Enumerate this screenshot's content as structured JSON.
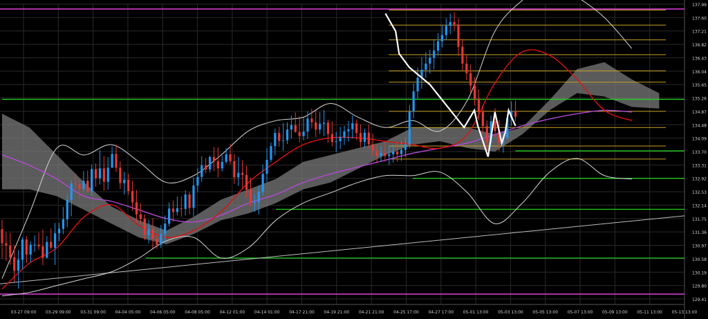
{
  "chart_data": {
    "type": "candlestick",
    "y_ticks": [
      "137.99",
      "137.60",
      "137.21",
      "136.82",
      "136.43",
      "136.04",
      "135.65",
      "135.26",
      "134.87",
      "134.48",
      "134.09",
      "133.70",
      "133.31",
      "132.92",
      "132.53",
      "132.14",
      "131.75",
      "131.36",
      "130.97",
      "130.58",
      "130.19",
      "129.80",
      "129.41"
    ],
    "x_ticks": [
      "03-27 09:00",
      "03-29 09:00",
      "03-31 09:00",
      "04-04 05:00",
      "04-06 05:00",
      "04-08 05:00",
      "04-12 01:00",
      "04-14 01:00",
      "04-17 21:00",
      "04-19 21:00",
      "04-21 21:00",
      "04-25 17:00",
      "04-27 17:00",
      "05-01 13:00",
      "05-03 13:00",
      "05-05 13:00",
      "05-07 13:00",
      "05-09 13:00",
      "05-11 13:00",
      "05-13 13:00"
    ],
    "ylim": [
      129.41,
      137.99
    ],
    "grid": true,
    "colors": {
      "background": "#000000",
      "grid": "#2a2a2a",
      "up_candle": "#2196f3",
      "down_candle": "#e53935",
      "ma_red": "#e01010",
      "ma_purple": "#b24bd6",
      "bollinger": "#d8d8d8",
      "cloud": "#7a7a7a",
      "support_green": "#22e022",
      "range_magenta": "#e040e0",
      "fib_gold": "#c9a227",
      "zigzag": "#ffffff",
      "trendline": "#bdbdbd"
    },
    "horizontal_levels": {
      "magenta": [
        137.85,
        129.55
      ],
      "green": [
        135.22,
        133.72,
        132.92,
        132.02,
        130.6
      ],
      "gold": [
        137.82,
        137.38,
        136.95,
        136.52,
        136.05,
        135.72,
        134.87,
        134.4,
        133.86,
        133.48
      ]
    },
    "trendline": {
      "start": [
        0,
        129.85
      ],
      "end": [
        200,
        131.83
      ]
    },
    "ohlc": [
      [
        131.44,
        131.71,
        130.58,
        131.03
      ],
      [
        131.03,
        131.35,
        130.52,
        130.96
      ],
      [
        130.96,
        131.33,
        130.4,
        130.62
      ],
      [
        130.62,
        130.96,
        129.9,
        130.23
      ],
      [
        130.23,
        130.83,
        129.71,
        130.55
      ],
      [
        130.55,
        131.21,
        130.28,
        131.14
      ],
      [
        131.14,
        131.24,
        130.45,
        130.7
      ],
      [
        130.7,
        131.09,
        130.47,
        130.99
      ],
      [
        130.99,
        131.26,
        130.78,
        130.99
      ],
      [
        130.99,
        131.34,
        130.84,
        130.94
      ],
      [
        130.94,
        131.42,
        130.39,
        130.61
      ],
      [
        130.61,
        131.24,
        130.59,
        131.07
      ],
      [
        131.07,
        131.46,
        130.85,
        130.9
      ],
      [
        130.9,
        131.62,
        130.4,
        131.32
      ],
      [
        131.32,
        131.62,
        131.09,
        131.45
      ],
      [
        131.45,
        132.09,
        131.3,
        131.73
      ],
      [
        131.73,
        132.45,
        131.5,
        132.29
      ],
      [
        132.29,
        132.86,
        131.82,
        132.77
      ],
      [
        132.77,
        133.06,
        132.59,
        132.75
      ],
      [
        132.75,
        132.91,
        132.34,
        132.61
      ],
      [
        132.61,
        133.13,
        132.54,
        132.85
      ],
      [
        132.85,
        133.15,
        132.52,
        132.54
      ],
      [
        132.54,
        133.32,
        132.42,
        133.19
      ],
      [
        133.19,
        133.35,
        132.68,
        132.92
      ],
      [
        132.92,
        133.74,
        132.74,
        133.21
      ],
      [
        133.21,
        133.57,
        132.56,
        132.82
      ],
      [
        132.82,
        133.54,
        132.59,
        133.23
      ],
      [
        133.23,
        133.85,
        133.23,
        133.63
      ],
      [
        133.63,
        133.91,
        133.1,
        133.23
      ],
      [
        133.23,
        133.41,
        132.61,
        132.78
      ],
      [
        132.78,
        133.11,
        132.45,
        132.88
      ],
      [
        132.88,
        133.05,
        132.44,
        132.55
      ],
      [
        132.55,
        132.85,
        131.97,
        132.22
      ],
      [
        132.22,
        132.58,
        131.64,
        131.87
      ],
      [
        131.87,
        132.2,
        131.58,
        131.74
      ],
      [
        131.74,
        131.87,
        131.12,
        131.27
      ],
      [
        131.27,
        131.71,
        131.03,
        131.44
      ],
      [
        131.44,
        131.76,
        130.88,
        131.16
      ],
      [
        131.16,
        131.3,
        130.87,
        130.99
      ],
      [
        130.99,
        131.56,
        130.89,
        131.3
      ],
      [
        131.3,
        131.84,
        131.05,
        131.6
      ],
      [
        131.6,
        132.22,
        131.52,
        132.04
      ],
      [
        132.04,
        132.28,
        131.66,
        131.94
      ],
      [
        131.94,
        132.39,
        131.84,
        132.05
      ],
      [
        132.05,
        132.39,
        131.8,
        132.03
      ],
      [
        132.03,
        132.57,
        131.84,
        132.45
      ],
      [
        132.45,
        132.52,
        131.87,
        132.06
      ],
      [
        132.06,
        132.95,
        131.8,
        132.71
      ],
      [
        132.71,
        133.22,
        132.52,
        132.96
      ],
      [
        132.96,
        133.56,
        132.82,
        133.3
      ],
      [
        133.3,
        133.51,
        133.07,
        133.18
      ],
      [
        133.18,
        133.58,
        133.09,
        133.54
      ],
      [
        133.54,
        133.83,
        133.13,
        133.42
      ],
      [
        133.42,
        133.82,
        132.95,
        133.21
      ],
      [
        133.21,
        133.59,
        133.12,
        133.4
      ],
      [
        133.4,
        133.8,
        133.35,
        133.62
      ],
      [
        133.62,
        133.93,
        133.33,
        133.42
      ],
      [
        133.42,
        133.63,
        132.76,
        132.95
      ],
      [
        132.95,
        133.55,
        132.7,
        133.08
      ],
      [
        133.08,
        133.45,
        132.62,
        133.02
      ],
      [
        133.02,
        133.29,
        132.36,
        132.59
      ],
      [
        132.59,
        132.94,
        132.11,
        132.22
      ],
      [
        132.22,
        132.47,
        131.94,
        132.22
      ],
      [
        132.22,
        132.71,
        131.87,
        132.53
      ],
      [
        132.53,
        133.32,
        132.43,
        133.05
      ],
      [
        133.05,
        133.8,
        132.81,
        133.46
      ],
      [
        133.46,
        133.96,
        133.39,
        133.86
      ],
      [
        133.86,
        134.37,
        133.59,
        134.24
      ],
      [
        134.24,
        134.42,
        133.84,
        134.01
      ],
      [
        134.01,
        134.53,
        133.72,
        134.03
      ],
      [
        134.03,
        134.55,
        133.92,
        134.34
      ],
      [
        134.34,
        134.75,
        134.07,
        134.47
      ],
      [
        134.47,
        134.84,
        134.25,
        134.27
      ],
      [
        134.27,
        134.73,
        133.96,
        134.15
      ],
      [
        134.15,
        134.69,
        134.03,
        134.28
      ],
      [
        134.28,
        134.87,
        134.07,
        134.66
      ],
      [
        134.66,
        134.95,
        134.37,
        134.55
      ],
      [
        134.55,
        134.9,
        134.12,
        134.34
      ],
      [
        134.34,
        134.85,
        134.21,
        134.51
      ],
      [
        134.51,
        134.91,
        134.15,
        134.54
      ],
      [
        134.54,
        134.63,
        133.95,
        134.21
      ],
      [
        134.21,
        134.58,
        133.85,
        133.98
      ],
      [
        133.98,
        134.27,
        133.69,
        134.0
      ],
      [
        134.0,
        134.42,
        133.77,
        134.12
      ],
      [
        134.12,
        134.45,
        133.89,
        134.29
      ],
      [
        134.29,
        134.59,
        133.99,
        134.35
      ],
      [
        134.35,
        134.75,
        134.08,
        134.52
      ],
      [
        134.52,
        134.63,
        134.03,
        134.24
      ],
      [
        134.24,
        134.49,
        133.83,
        133.98
      ],
      [
        133.98,
        134.37,
        133.82,
        134.25
      ],
      [
        134.25,
        134.49,
        133.78,
        133.91
      ],
      [
        133.91,
        134.22,
        133.58,
        133.72
      ],
      [
        133.72,
        133.91,
        133.36,
        133.57
      ],
      [
        133.57,
        133.86,
        133.4,
        133.66
      ],
      [
        133.66,
        133.98,
        133.41,
        133.57
      ],
      [
        133.57,
        133.87,
        133.31,
        133.62
      ],
      [
        133.62,
        133.89,
        133.37,
        133.7
      ],
      [
        133.7,
        133.97,
        133.4,
        133.62
      ],
      [
        133.62,
        134.01,
        133.43,
        133.75
      ],
      [
        133.75,
        134.09,
        133.55,
        133.91
      ],
      [
        133.91,
        135.06,
        133.8,
        134.87
      ],
      [
        134.87,
        135.68,
        134.66,
        135.45
      ],
      [
        135.45,
        136.14,
        135.24,
        135.85
      ],
      [
        135.85,
        136.45,
        135.53,
        136.08
      ],
      [
        136.08,
        136.59,
        135.84,
        136.26
      ],
      [
        136.26,
        136.66,
        135.97,
        136.43
      ],
      [
        136.43,
        136.97,
        136.09,
        136.64
      ],
      [
        136.64,
        137.15,
        136.5,
        136.91
      ],
      [
        136.91,
        137.38,
        136.73,
        137.09
      ],
      [
        137.09,
        137.58,
        136.96,
        137.36
      ],
      [
        137.36,
        137.72,
        137.12,
        137.47
      ],
      [
        137.47,
        137.75,
        137.22,
        137.4
      ],
      [
        137.4,
        137.58,
        136.48,
        136.75
      ],
      [
        136.75,
        136.98,
        136.06,
        136.26
      ],
      [
        136.26,
        136.53,
        135.78,
        135.98
      ],
      [
        135.98,
        136.23,
        135.41,
        135.62
      ],
      [
        135.62,
        135.86,
        135.04,
        135.24
      ],
      [
        135.24,
        135.51,
        134.61,
        134.85
      ],
      [
        134.85,
        135.06,
        134.22,
        134.44
      ],
      [
        134.44,
        134.61,
        133.71,
        133.96
      ],
      [
        133.96,
        134.74,
        133.82,
        134.58
      ],
      [
        134.58,
        134.96,
        134.12,
        134.3
      ],
      [
        134.3,
        134.61,
        133.72,
        133.95
      ],
      [
        133.95,
        134.27,
        133.67,
        134.1
      ],
      [
        134.1,
        134.78,
        134.04,
        134.68
      ],
      [
        134.68,
        135.16,
        134.45,
        134.88
      ],
      [
        134.88,
        135.18,
        134.58,
        134.71
      ]
    ],
    "ma_red": [
      [
        0,
        129.7
      ],
      [
        8,
        130.45
      ],
      [
        16,
        130.9
      ],
      [
        24,
        131.8
      ],
      [
        32,
        132.15
      ],
      [
        40,
        131.55
      ],
      [
        48,
        131.2
      ],
      [
        56,
        131.4
      ],
      [
        64,
        131.95
      ],
      [
        72,
        132.8
      ],
      [
        80,
        133.4
      ],
      [
        88,
        133.9
      ],
      [
        96,
        134.1
      ],
      [
        104,
        134.1
      ],
      [
        112,
        134.0
      ],
      [
        120,
        133.9
      ],
      [
        128,
        133.8
      ],
      [
        136,
        134.2
      ],
      [
        144,
        135.7
      ],
      [
        152,
        136.6
      ],
      [
        160,
        136.5
      ],
      [
        168,
        135.8
      ],
      [
        176,
        134.9
      ],
      [
        184,
        134.6
      ]
    ],
    "ma_purple": [
      [
        0,
        133.6
      ],
      [
        8,
        133.3
      ],
      [
        16,
        132.9
      ],
      [
        24,
        132.4
      ],
      [
        32,
        132.25
      ],
      [
        40,
        132.0
      ],
      [
        48,
        131.75
      ],
      [
        56,
        131.65
      ],
      [
        64,
        131.85
      ],
      [
        72,
        132.2
      ],
      [
        80,
        132.45
      ],
      [
        88,
        132.8
      ],
      [
        96,
        133.05
      ],
      [
        104,
        133.25
      ],
      [
        112,
        133.45
      ],
      [
        120,
        133.65
      ],
      [
        128,
        133.8
      ],
      [
        136,
        133.95
      ],
      [
        144,
        134.2
      ],
      [
        152,
        134.45
      ],
      [
        160,
        134.65
      ],
      [
        168,
        134.8
      ],
      [
        176,
        134.9
      ],
      [
        184,
        134.85
      ]
    ],
    "bb_upper": [
      [
        0,
        130.0
      ],
      [
        8,
        131.9
      ],
      [
        16,
        133.8
      ],
      [
        24,
        133.6
      ],
      [
        32,
        133.9
      ],
      [
        40,
        133.4
      ],
      [
        48,
        132.8
      ],
      [
        56,
        133.0
      ],
      [
        64,
        133.6
      ],
      [
        72,
        134.3
      ],
      [
        80,
        134.6
      ],
      [
        88,
        134.7
      ],
      [
        96,
        135.1
      ],
      [
        104,
        134.7
      ],
      [
        112,
        134.4
      ],
      [
        120,
        134.6
      ],
      [
        128,
        134.3
      ],
      [
        136,
        135.2
      ],
      [
        144,
        137.2
      ],
      [
        152,
        138.1
      ],
      [
        160,
        138.6
      ],
      [
        168,
        138.2
      ],
      [
        176,
        137.6
      ],
      [
        184,
        136.7
      ]
    ],
    "bb_lower": [
      [
        0,
        129.5
      ],
      [
        8,
        129.6
      ],
      [
        16,
        129.8
      ],
      [
        24,
        130.0
      ],
      [
        32,
        130.2
      ],
      [
        40,
        130.6
      ],
      [
        48,
        131.1
      ],
      [
        56,
        131.2
      ],
      [
        64,
        130.6
      ],
      [
        72,
        130.9
      ],
      [
        80,
        131.7
      ],
      [
        88,
        132.2
      ],
      [
        96,
        132.5
      ],
      [
        104,
        132.8
      ],
      [
        112,
        133.0
      ],
      [
        120,
        133.0
      ],
      [
        128,
        133.1
      ],
      [
        136,
        132.5
      ],
      [
        144,
        131.6
      ],
      [
        152,
        132.2
      ],
      [
        160,
        133.1
      ],
      [
        168,
        133.5
      ],
      [
        176,
        133.0
      ],
      [
        184,
        132.9
      ]
    ],
    "cloud_top": [
      [
        0,
        134.8
      ],
      [
        8,
        134.4
      ],
      [
        16,
        133.6
      ],
      [
        24,
        132.8
      ],
      [
        32,
        132.1
      ],
      [
        40,
        131.7
      ],
      [
        48,
        131.4
      ],
      [
        56,
        131.8
      ],
      [
        64,
        132.3
      ],
      [
        72,
        132.6
      ],
      [
        80,
        132.9
      ],
      [
        88,
        133.4
      ],
      [
        96,
        133.6
      ],
      [
        104,
        133.8
      ],
      [
        112,
        134.0
      ],
      [
        120,
        134.4
      ],
      [
        128,
        134.4
      ],
      [
        136,
        134.4
      ],
      [
        144,
        134.2
      ],
      [
        152,
        134.4
      ],
      [
        160,
        135.2
      ],
      [
        168,
        136.1
      ],
      [
        176,
        136.3
      ],
      [
        184,
        135.8
      ],
      [
        192,
        135.4
      ]
    ],
    "cloud_bottom": [
      [
        0,
        132.6
      ],
      [
        8,
        132.6
      ],
      [
        16,
        132.4
      ],
      [
        24,
        132.0
      ],
      [
        32,
        131.6
      ],
      [
        40,
        131.2
      ],
      [
        48,
        131.0
      ],
      [
        56,
        131.3
      ],
      [
        64,
        131.7
      ],
      [
        72,
        131.9
      ],
      [
        80,
        132.2
      ],
      [
        88,
        132.6
      ],
      [
        96,
        132.8
      ],
      [
        104,
        133.2
      ],
      [
        112,
        133.6
      ],
      [
        120,
        133.9
      ],
      [
        128,
        134.0
      ],
      [
        136,
        133.8
      ],
      [
        144,
        133.7
      ],
      [
        152,
        134.2
      ],
      [
        160,
        134.9
      ],
      [
        168,
        135.4
      ],
      [
        176,
        135.3
      ],
      [
        184,
        135.0
      ],
      [
        192,
        134.95
      ]
    ],
    "zigzag": [
      [
        112,
        137.72
      ],
      [
        115,
        137.2
      ],
      [
        116,
        136.55
      ],
      [
        119,
        136.15
      ],
      [
        125,
        135.65
      ],
      [
        135,
        134.4
      ],
      [
        138,
        134.9
      ],
      [
        139,
        134.45
      ],
      [
        142,
        133.55
      ],
      [
        144,
        134.85
      ],
      [
        146,
        133.95
      ],
      [
        147,
        134.25
      ],
      [
        148,
        134.9
      ],
      [
        150,
        134.45
      ]
    ],
    "fib_start_index": 113,
    "fib_end_index": 200
  }
}
